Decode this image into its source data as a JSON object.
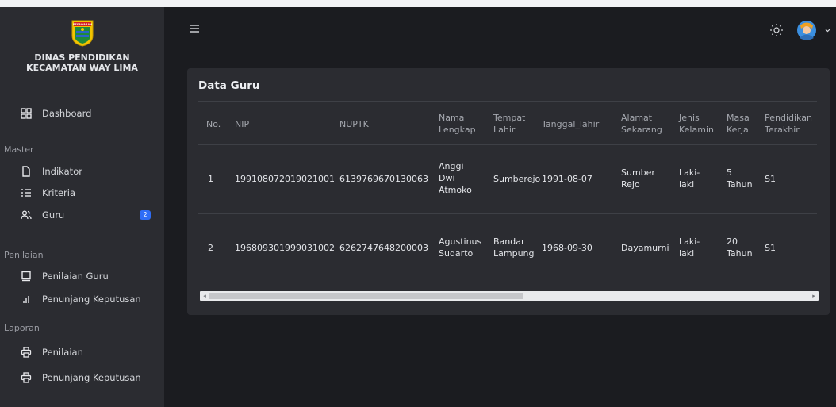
{
  "sidebar": {
    "brand": {
      "logo_text": "PESAWARAN",
      "line1": "DINAS PENDIDIKAN",
      "line2": "KECAMATAN WAY LIMA"
    },
    "dashboard": "Dashboard",
    "sections": {
      "master": "Master",
      "penilaian": "Penilaian",
      "laporan": "Laporan"
    },
    "master_items": [
      {
        "label": "Indikator",
        "icon": "file-icon"
      },
      {
        "label": "Kriteria",
        "icon": "list-icon"
      },
      {
        "label": "Guru",
        "icon": "users-icon",
        "badge": "2"
      }
    ],
    "penilaian_items": [
      {
        "label": "Penilaian Guru",
        "icon": "monitor-icon"
      },
      {
        "label": "Penunjang Keputusan",
        "icon": "bar-chart-icon"
      }
    ],
    "laporan_items": [
      {
        "label": "Penilaian",
        "icon": "printer-icon"
      },
      {
        "label": "Penunjang Keputusan",
        "icon": "printer-icon"
      }
    ]
  },
  "header": {
    "menu_icon": "hamburger-icon",
    "theme_icon": "sun-icon",
    "avatar_icon": "user-avatar-icon"
  },
  "card": {
    "title": "Data Guru",
    "columns": {
      "no": "No.",
      "nip": "NIP",
      "nuptk": "NUPTK",
      "nama": [
        "Nama",
        "Lengkap"
      ],
      "tempat": [
        "Tempat",
        "Lahir"
      ],
      "tanggal": "Tanggal_lahir",
      "alamat": [
        "Alamat",
        "Sekarang"
      ],
      "jenis": [
        "Jenis",
        "Kelamin"
      ],
      "masa": [
        "Masa",
        "Kerja"
      ],
      "pendidikan": [
        "Pendidikan",
        "Terakhir"
      ]
    },
    "rows": [
      {
        "no": "1",
        "nip": "199108072019021001",
        "nuptk": "6139769670130063",
        "nama": [
          "Anggi",
          "Dwi",
          "Atmoko"
        ],
        "tempat": [
          "Sumberejo"
        ],
        "tanggal": "1991-08-07",
        "alamat": [
          "Sumber",
          "Rejo"
        ],
        "jenis": [
          "Laki-",
          "laki"
        ],
        "masa": [
          "5",
          "Tahun"
        ],
        "pendidikan": "S1"
      },
      {
        "no": "2",
        "nip": "196809301999031002",
        "nuptk": "6262747648200003",
        "nama": [
          "Agustinus",
          "Sudarto"
        ],
        "tempat": [
          "Bandar",
          "Lampung"
        ],
        "tanggal": "1968-09-30",
        "alamat": [
          "Dayamurni"
        ],
        "jenis": [
          "Laki-",
          "laki"
        ],
        "masa": [
          "20",
          "Tahun"
        ],
        "pendidikan": "S1"
      }
    ],
    "scrollbar": {
      "left_arrow": "◂",
      "right_arrow": "▸"
    }
  }
}
